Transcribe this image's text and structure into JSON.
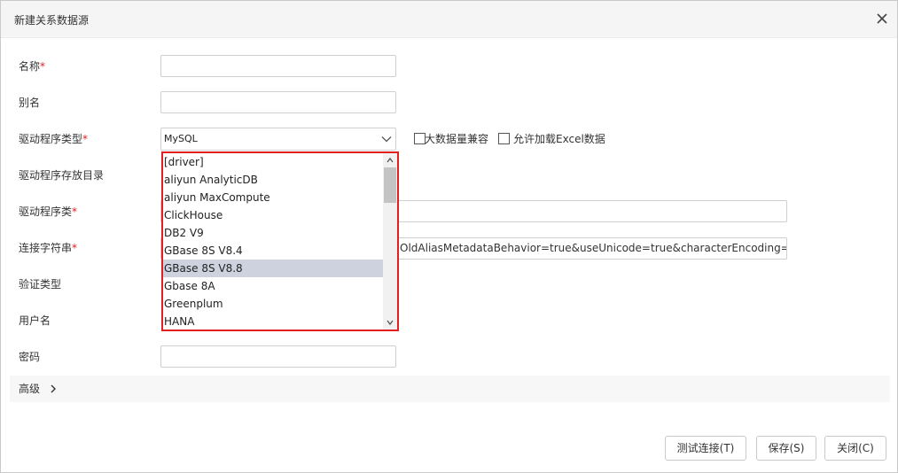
{
  "dialog": {
    "title": "新建关系数据源"
  },
  "form": {
    "name_label": "名称",
    "alias_label": "别名",
    "driver_type_label": "驱动程序类型",
    "driver_dir_label": "驱动程序存放目录",
    "driver_class_label": "驱动程序类",
    "conn_string_label": "连接字符串",
    "auth_type_label": "验证类型",
    "username_label": "用户名",
    "password_label": "密码",
    "required_mark": "*",
    "name_value": "",
    "alias_value": "",
    "driver_class_value": "",
    "conn_string_value": "OldAliasMetadataBehavior=true&useUnicode=true&characterEncoding=GB",
    "password_value": ""
  },
  "driver_select": {
    "selected": "MySQL",
    "options": [
      "[driver]",
      "aliyun AnalyticDB",
      "aliyun MaxCompute",
      "ClickHouse",
      "DB2 V9",
      "GBase 8S V8.4",
      "GBase 8S V8.8",
      "Gbase 8A",
      "Greenplum",
      "HANA"
    ],
    "highlighted": "GBase 8S V8.8"
  },
  "options": {
    "big_data_label": "大数据量兼容",
    "excel_label": "允许加载Excel数据",
    "big_data_checked": false,
    "excel_checked": false
  },
  "advanced": {
    "label": "高级"
  },
  "buttons": {
    "test": "测试连接(T)",
    "save": "保存(S)",
    "close": "关闭(C)"
  },
  "colors": {
    "required": "#e02020",
    "dropdown_border": "#e32020",
    "highlight": "#cdd2de"
  },
  "icons": {
    "close": "close-icon",
    "chevron": "chevron-down-icon",
    "advanced": "chevron-right-icon"
  }
}
